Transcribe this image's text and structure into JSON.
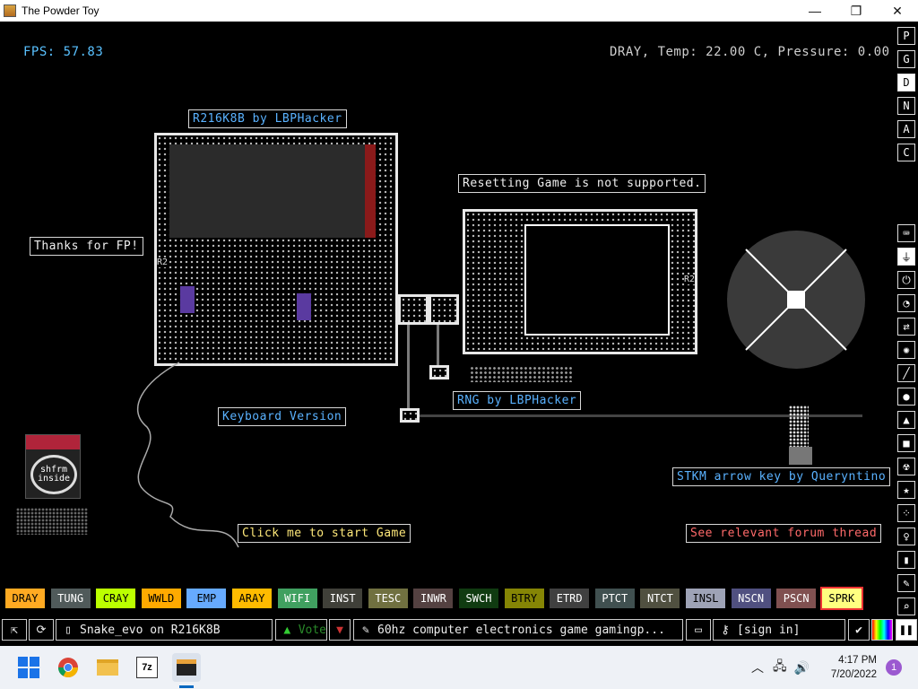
{
  "window": {
    "title": "The Powder Toy",
    "minimize": "—",
    "maximize": "❐",
    "close": "✕"
  },
  "hud": {
    "fps": "FPS: 57.83",
    "status": "DRAY, Temp: 22.00 C, Pressure: 0.00"
  },
  "signs": {
    "r216": "R216K8B by LBPHacker",
    "thanks": "Thanks for FP!",
    "keyboard": "Keyboard Version",
    "reset": "Resetting Game is not supported.",
    "rng": "RNG by LBPHacker",
    "stkm": "STKM arrow key by Queryntino",
    "click": "Click me to start Game",
    "forum": "See relevant forum thread"
  },
  "board_labels": {
    "left": "R2",
    "right": "R2"
  },
  "logo": {
    "text": "shfrm inside"
  },
  "right_toolbar_top": [
    "P",
    "G",
    "D",
    "N",
    "A",
    "C"
  ],
  "right_toolbar_icons": [
    "keyboard-icon",
    "power-plug-icon",
    "power-icon",
    "gauge-icon",
    "arrows-icon",
    "gear-icon",
    "brush-icon",
    "drop-icon",
    "flask-icon",
    "square-icon",
    "radiation-icon",
    "star-icon",
    "dots-icon",
    "bulb-icon",
    "bookmark-icon",
    "wrench-icon",
    "search-icon"
  ],
  "elements": [
    {
      "label": "DRAY",
      "bg": "#ffaa22"
    },
    {
      "label": "TUNG",
      "bg": "#505a5a"
    },
    {
      "label": "CRAY",
      "bg": "#bbff00"
    },
    {
      "label": "WWLD",
      "bg": "#ffaa00"
    },
    {
      "label": "EMP",
      "bg": "#66aaff"
    },
    {
      "label": "ARAY",
      "bg": "#ffbb00"
    },
    {
      "label": "WIFI",
      "bg": "#40a060"
    },
    {
      "label": "INST",
      "bg": "#404039"
    },
    {
      "label": "TESC",
      "bg": "#707040"
    },
    {
      "label": "INWR",
      "bg": "#544141"
    },
    {
      "label": "SWCH",
      "bg": "#103b11"
    },
    {
      "label": "BTRY",
      "bg": "#858505"
    },
    {
      "label": "ETRD",
      "bg": "#404040"
    },
    {
      "label": "PTCT",
      "bg": "#405050"
    },
    {
      "label": "NTCT",
      "bg": "#505040"
    },
    {
      "label": "INSL",
      "bg": "#9ea3b6"
    },
    {
      "label": "NSCN",
      "bg": "#505080"
    },
    {
      "label": "PSCN",
      "bg": "#805050"
    },
    {
      "label": "SPRK",
      "bg": "#ffff80"
    }
  ],
  "bottom_bar": {
    "save_name": "Snake_evo on R216K8B",
    "vote": "Vote",
    "tags": "60hz computer electronics game gamingp...",
    "sign_in": "[sign in]"
  },
  "taskbar": {
    "time": "4:17 PM",
    "date": "7/20/2022",
    "notifications": "1",
    "app_7z": "7z"
  },
  "colors": {
    "accent_blue": "#5ab2ff",
    "hud_blue": "#59c1ff",
    "selected_border": "#ee3333"
  }
}
